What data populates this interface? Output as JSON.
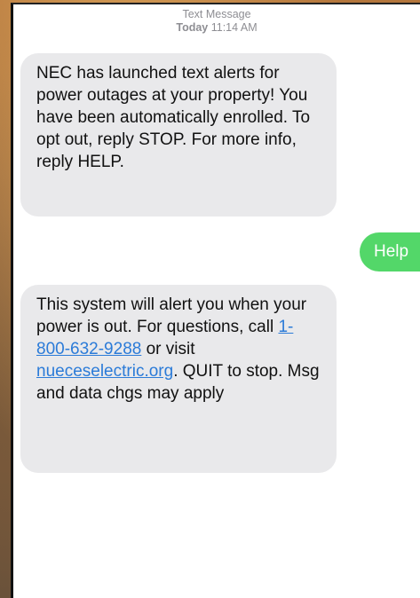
{
  "thread": {
    "kind": "Text Message",
    "day": "Today",
    "time": "11:14 AM"
  },
  "messages": [
    {
      "direction": "incoming",
      "text": "NEC has launched text alerts for power outages at your property! You have been automatically enrolled. To opt out, reply STOP. For more info, reply HELP."
    },
    {
      "direction": "outgoing",
      "text": "Help"
    },
    {
      "direction": "incoming",
      "text_before_phone": "This system will alert you when your power is out. For questions, call ",
      "phone": "1-800-632-9288",
      "text_between": " or visit ",
      "website": "nueceselectric.org",
      "text_after": ".  QUIT to stop. Msg and data chgs may apply"
    }
  ],
  "colors": {
    "incoming_bubble": "#e9e9eb",
    "outgoing_bubble": "#53d769",
    "link": "#2b7bd8",
    "header_text": "#8e8e93"
  }
}
